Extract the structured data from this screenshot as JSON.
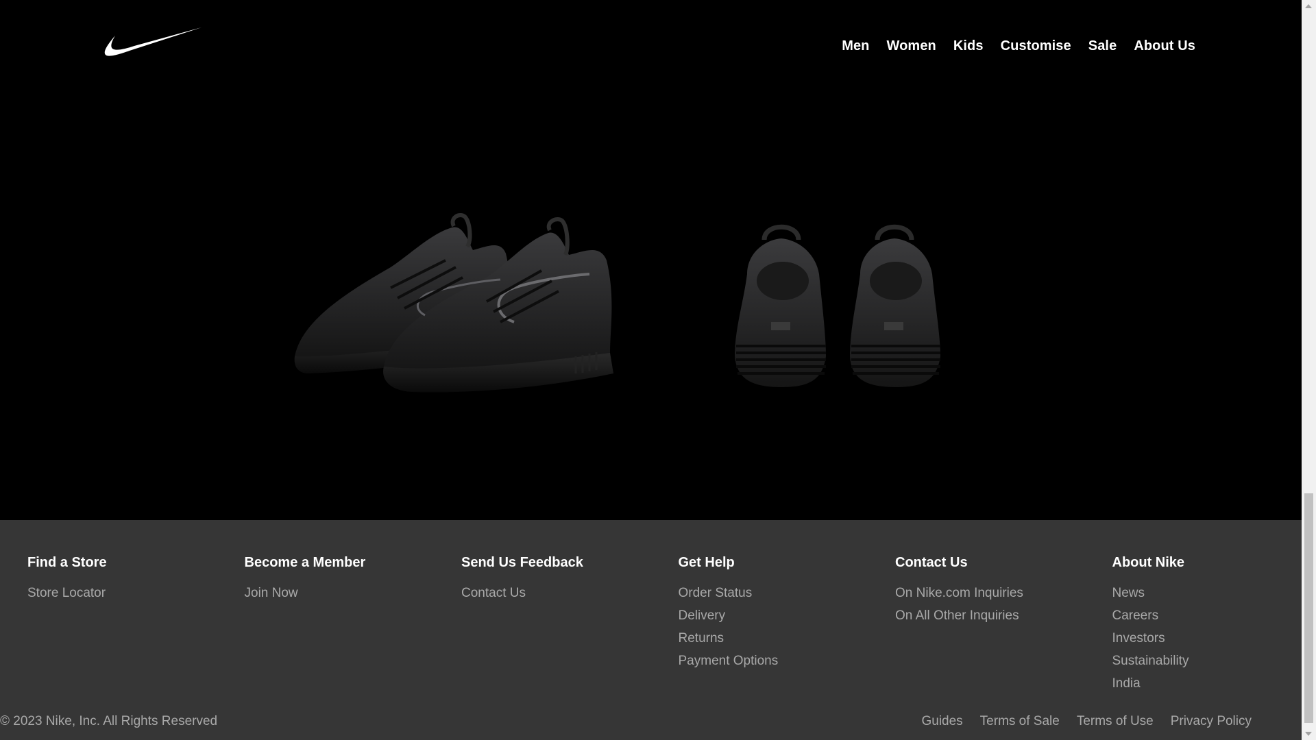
{
  "header": {
    "logo": "nike-swoosh-logo",
    "nav": [
      "Men",
      "Women",
      "Kids",
      "Customise",
      "Sale",
      "About Us"
    ]
  },
  "hero": {
    "images": [
      "shoe-pair-side-view",
      "shoe-pair-back-view"
    ]
  },
  "footer": {
    "columns": [
      {
        "heading": "Find a Store",
        "links": [
          "Store Locator"
        ]
      },
      {
        "heading": "Become a Member",
        "links": [
          "Join Now"
        ]
      },
      {
        "heading": "Send Us Feedback",
        "links": [
          "Contact Us"
        ]
      },
      {
        "heading": "Get Help",
        "links": [
          "Order Status",
          "Delivery",
          "Returns",
          "Payment Options"
        ]
      },
      {
        "heading": "Contact Us",
        "links": [
          "On Nike.com Inquiries",
          "On All Other Inquiries"
        ]
      },
      {
        "heading": "About Nike",
        "links": [
          "News",
          "Careers",
          "Investors",
          "Sustainability",
          "India"
        ]
      }
    ],
    "copyright": "© 2023 Nike, Inc. All Rights Reserved",
    "legal": [
      "Guides",
      "Terms of Sale",
      "Terms of Use",
      "Privacy Policy"
    ]
  },
  "colors": {
    "background": "#000000",
    "footer_bg": "#363636",
    "footer_link": "#a9a9a9",
    "heading": "#ffffff"
  }
}
